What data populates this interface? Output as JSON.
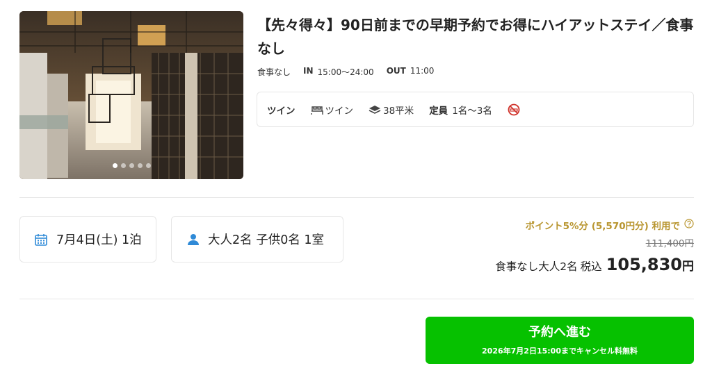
{
  "plan": {
    "title": "【先々得々】90日前までの早期予約でお得にハイアットステイ／食事なし",
    "meal": "食事なし",
    "checkin_label": "IN",
    "checkin_time": "15:00〜24:00",
    "checkout_label": "OUT",
    "checkout_time": "11:00"
  },
  "photo": {
    "slides": 5,
    "active_index": 0
  },
  "room": {
    "name": "ツイン",
    "bed": "ツイン",
    "area": "38平米",
    "capacity_label": "定員",
    "capacity_value": "1名〜3名",
    "smoking_icon": "no-smoking-icon"
  },
  "stay": {
    "date_text": "7月4日(土) 1泊",
    "guests_text": "大人2名 子供0名 1室"
  },
  "price": {
    "points_text": "ポイント5%分 (5,570円分) 利用で",
    "original_price": "111,400円",
    "plan_desc": "食事なし大人2名",
    "tax_label": "税込",
    "amount": "105,830",
    "currency": "円"
  },
  "cta": {
    "label": "予約へ進む",
    "note": "2026年7月2日15:00までキャンセル料無料"
  },
  "colors": {
    "accent_green": "#06c100",
    "points_gold": "#b8952f",
    "icon_blue": "#2f8ad7",
    "no_smoking_red": "#d0342c"
  }
}
